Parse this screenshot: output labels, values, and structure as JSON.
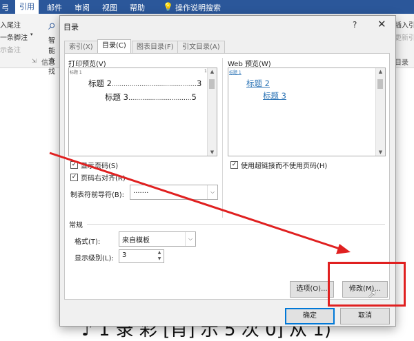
{
  "ribbon": {
    "tabs": [
      "弓",
      "引用",
      "邮件",
      "审阅",
      "视图",
      "帮助",
      "操作说明搜索"
    ],
    "left_items": [
      "入尾注",
      "一条脚注",
      "示备注"
    ],
    "group_label": "信息",
    "right_items": [
      "插入引文",
      "更新引文"
    ],
    "right_group_label": "目录",
    "big_button_label": "智能查找"
  },
  "dialog": {
    "title": "目录",
    "help_label": "?",
    "close_label": "✕",
    "tabs": [
      {
        "label": "索引(X)",
        "active": false
      },
      {
        "label": "目录(C)",
        "active": true
      },
      {
        "label": "图表目录(F)",
        "active": false
      },
      {
        "label": "引文目录(A)",
        "active": false
      }
    ],
    "print_preview": {
      "label": "打印预览(V)",
      "top_line": "标题 1",
      "top_page": "1",
      "lines": [
        {
          "text": "标题 2",
          "dots": "...........................................",
          "page": "3"
        },
        {
          "text": "标题 3",
          "dots": "................................",
          "page": "5"
        }
      ]
    },
    "web_preview": {
      "label": "Web 预览(W)",
      "top_line": "标题 1",
      "links": [
        "标题 2",
        "标题 3"
      ]
    },
    "show_page_numbers": {
      "label": "显示页码(S)",
      "checked": true
    },
    "right_align_page_numbers": {
      "label": "页码右对齐(R)",
      "checked": true
    },
    "tab_leader": {
      "label": "制表符前导符(B):",
      "value": "......."
    },
    "use_hyperlinks": {
      "label": "使用超链接而不使用页码(H)",
      "checked": true
    },
    "general": {
      "label": "常规",
      "format": {
        "label": "格式(T):",
        "value": "来自模板"
      },
      "levels": {
        "label": "显示级别(L):",
        "value": "3"
      }
    },
    "buttons": {
      "options": "选项(O)...",
      "modify": "修改(M)...",
      "ok": "确定",
      "cancel": "取消"
    }
  },
  "document_text": "♪ 1 录 彩 [肖] 示 5 次 0] 从 1)",
  "colors": {
    "ribbon_blue": "#2b579a",
    "link_blue": "#2e75b6",
    "annotation_red": "#e02020"
  }
}
